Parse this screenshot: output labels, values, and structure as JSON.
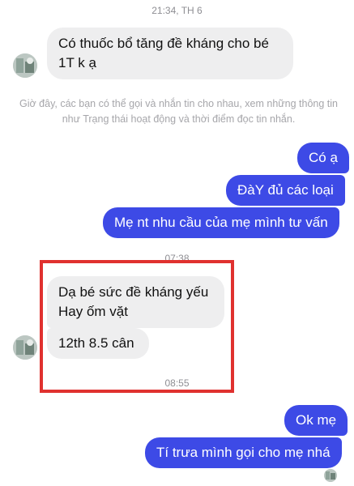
{
  "header": {
    "timestamp": "21:34, TH 6"
  },
  "messages": {
    "incoming_1": "Có thuốc bổ tăng đề kháng cho bé 1T k ạ",
    "info": "Giờ đây, các bạn có thể gọi và nhắn tin cho nhau, xem những thông tin như Trạng thái hoạt động và thời điểm đọc tin nhắn.",
    "out_1": "Có ạ",
    "out_2": "ĐàY đủ các loại",
    "out_3": "Mẹ nt nhu cầu của mẹ mình tư vấn",
    "ts_2": "07:38",
    "incoming_2": "Dạ bé sức đề kháng yếu Hay ốm vặt",
    "incoming_3": "12th 8.5 cân",
    "ts_3": "08:55",
    "out_4": "Ok mẹ",
    "out_5": "Tí trưa mình gọi cho mẹ nhá"
  },
  "colors": {
    "outgoing_bubble": "#3d4ae6",
    "incoming_bubble": "#eeeeef",
    "highlight_border": "#e0312f"
  },
  "icons": {
    "avatar": "contact-avatar",
    "read_receipt": "read-receipt-avatar"
  }
}
